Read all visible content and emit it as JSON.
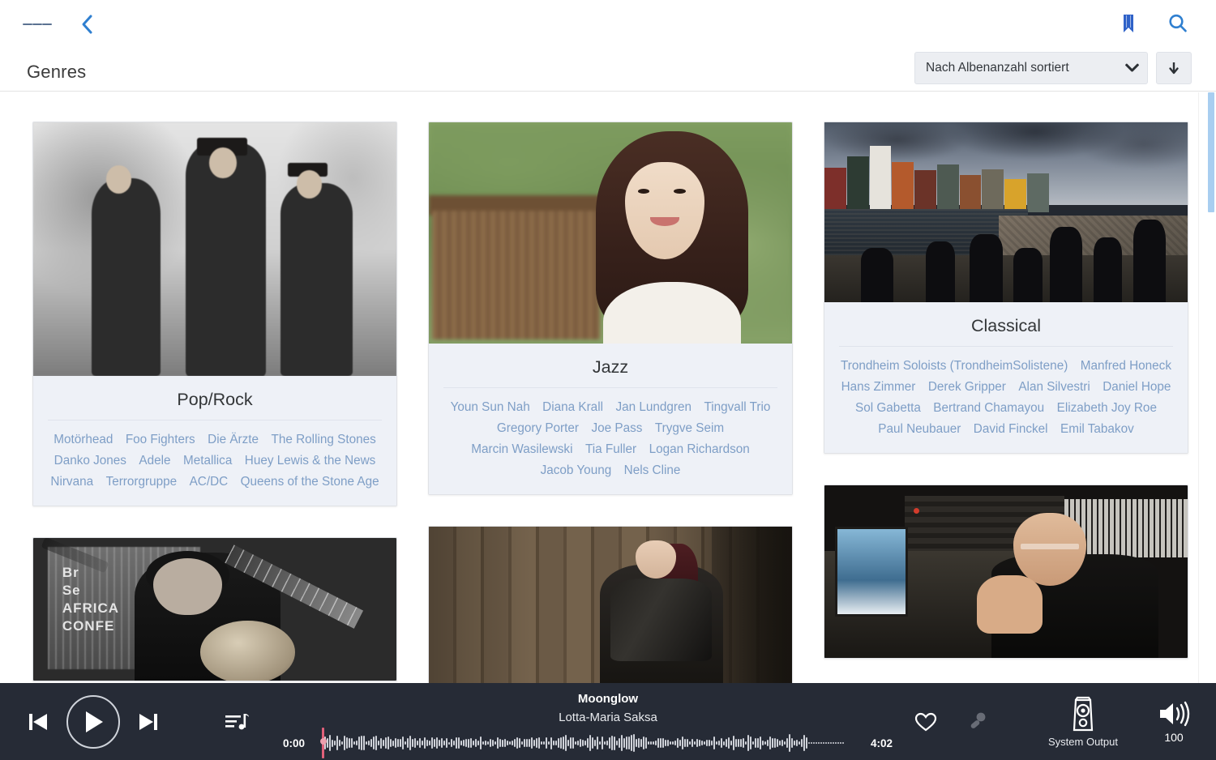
{
  "header": {
    "page_title": "Genres",
    "menu_icon": "hamburger-icon",
    "back_icon": "chevron-left-icon",
    "bookmark_icon": "bookmark-icon",
    "search_icon": "search-icon",
    "sort_value": "Nach Albenanzahl sortiert",
    "sort_chevron_icon": "chevron-down-icon",
    "sort_direction_icon": "arrow-down-icon",
    "accent_color": "#2f7fd0"
  },
  "genres": [
    {
      "name": "Pop/Rock",
      "image_alt": "motorhead-band-photo-black-and-white",
      "artists": [
        "Motörhead",
        "Foo Fighters",
        "Die Ärzte",
        "The Rolling Stones",
        "Danko Jones",
        "Adele",
        "Metallica",
        "Huey Lewis & the News",
        "Nirvana",
        "Terrorgruppe",
        "AC/DC",
        "Queens of the Stone Age"
      ]
    },
    {
      "name": "Jazz",
      "image_alt": "youn-sun-nah-portrait-green-background",
      "artists": [
        "Youn Sun Nah",
        "Diana Krall",
        "Jan Lundgren",
        "Tingvall Trio",
        "Gregory Porter",
        "Joe Pass",
        "Trygve Seim",
        "Marcin Wasilewski",
        "Tia Fuller",
        "Logan Richardson",
        "Jacob Young",
        "Nels Cline"
      ]
    },
    {
      "name": "Classical",
      "image_alt": "trondheim-soloists-waterfront-orchestra",
      "artists": [
        "Trondheim Soloists (TrondheimSolistene)",
        "Manfred Honeck",
        "Hans Zimmer",
        "Derek Gripper",
        "Alan Silvestri",
        "Daniel Hope",
        "Sol Gabetta",
        "Bertrand Chamayou",
        "Elizabeth Joy Roe",
        "Paul Neubauer",
        "David Finckel",
        "Emil Tabakov"
      ]
    }
  ],
  "second_row": [
    {
      "image_alt": "acoustic-guitarist-live-black-and-white",
      "overlay_text": "Br\nSe\nAFRICA\nCONFE"
    },
    {
      "image_alt": "woman-leather-jacket-wooden-wall"
    },
    {
      "image_alt": "composer-in-recording-studio"
    }
  ],
  "player": {
    "prev_icon": "skip-previous-icon",
    "play_icon": "play-icon",
    "next_icon": "skip-next-icon",
    "queue_icon": "playlist-queue-icon",
    "track_title": "Moonglow",
    "track_artist": "Lotta-Maria Saksa",
    "time_elapsed": "0:00",
    "time_total": "4:02",
    "favorite_icon": "heart-icon",
    "lyrics_icon": "microphone-icon",
    "output_icon": "speaker-icon",
    "output_label": "System Output",
    "volume_icon": "volume-up-icon",
    "volume_value": "100",
    "playhead_color": "#e0607a"
  },
  "scrollbar": {
    "thumb_color": "#a8cef0"
  }
}
